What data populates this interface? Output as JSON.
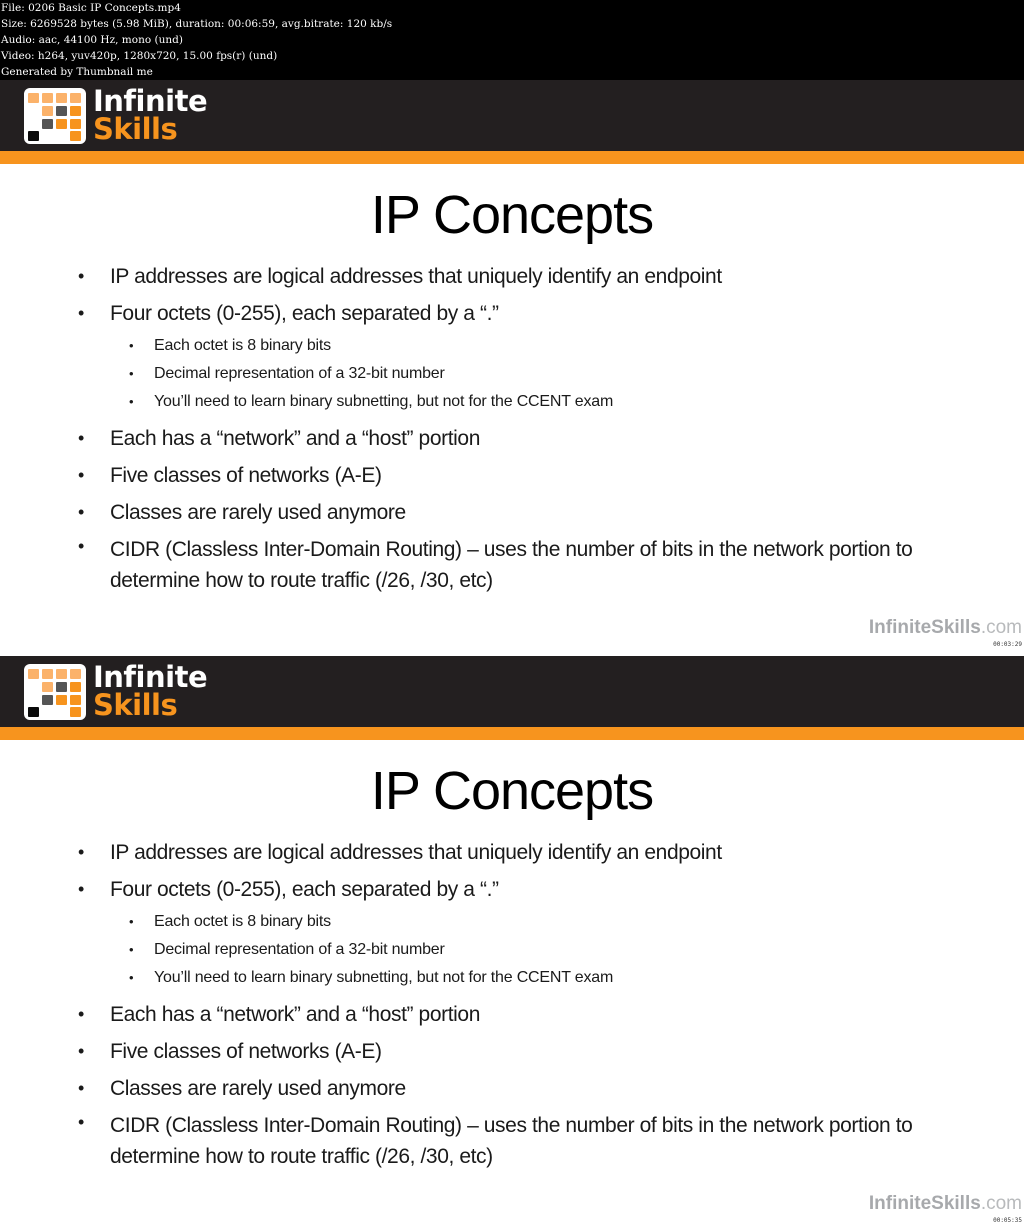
{
  "file_info": {
    "lines": [
      "File: 0206 Basic IP Concepts.mp4",
      "Size: 6269528 bytes (5.98 MiB), duration: 00:06:59, avg.bitrate: 120 kb/s",
      "Audio: aac, 44100 Hz, mono (und)",
      "Video: h264, yuv420p, 1280x720, 15.00 fps(r) (und)",
      "Generated by Thumbnail me"
    ]
  },
  "brand": {
    "line1": "Infinite",
    "line2": "Skills",
    "accent_color": "#f7941e",
    "header_color": "#231f20"
  },
  "slide": {
    "title": "IP Concepts",
    "bullets": [
      "IP addresses are logical addresses that uniquely identify an endpoint",
      "Four octets (0-255), each separated by a “.”",
      "Each has a “network” and a “host” portion",
      "Five classes of networks (A-E)",
      "Classes are rarely used anymore",
      "CIDR (Classless Inter-Domain Routing) – uses the number of bits in the network portion to determine how to route traffic (/26, /30, etc)"
    ],
    "sub_bullets": [
      "Each octet is 8 binary bits",
      "Decimal representation of a 32-bit number",
      "You’ll need to learn binary subnetting, but not for the CCENT exam"
    ],
    "bullet_glyph": "•"
  },
  "footer": {
    "brand_bold": "InfiniteSkills",
    "brand_suffix": ".com"
  },
  "frames": [
    {
      "timestamp": "00:03:29"
    },
    {
      "timestamp": "00:05:35"
    }
  ]
}
